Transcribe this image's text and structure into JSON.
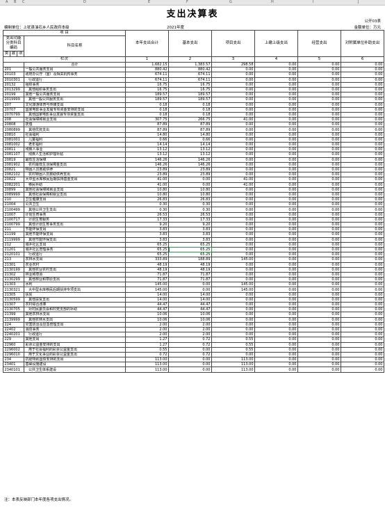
{
  "sheet_columns": [
    "A",
    "B",
    "C",
    "D",
    "E",
    "F",
    "G",
    "H",
    "I",
    "J"
  ],
  "title": "支出决算表",
  "form_no": "公开03表",
  "unit": "编制单位：上犹县油石乡人民政府本级",
  "year": "2021年度",
  "money_unit": "金额单位：万元",
  "headers": {
    "item": "项    目",
    "code": "支出功能分类科目编码",
    "name": "科目名称",
    "total": "本年支出合计",
    "basic": "基本支出",
    "project": "项目支出",
    "upper": "上缴上级支出",
    "business": "经营支出",
    "subsidy": "对附属单位补助支出",
    "lei": "类",
    "kuan": "款",
    "xiang": "项",
    "lanci": "栏次",
    "col_nums": [
      "1",
      "2",
      "3",
      "4",
      "5",
      "6"
    ]
  },
  "rows": [
    {
      "code": "",
      "name": "合计",
      "v": [
        "1,682.15",
        "1,383.57",
        "298.58",
        "0.00",
        "0.00",
        "0.00"
      ]
    },
    {
      "code": "201",
      "name": "一般公共服务支出",
      "v": [
        "880.42",
        "880.42",
        "0.00",
        "0.00",
        "0.00",
        "0.00"
      ]
    },
    {
      "code": "20103",
      "name": "政府办公厅（室）及相关机构事务",
      "v": [
        "674.11",
        "674.11",
        "0.00",
        "0.00",
        "0.00",
        "0.00"
      ]
    },
    {
      "code": "2010301",
      "name": "行政运行",
      "v": [
        "674.11",
        "674.11",
        "0.00",
        "0.00",
        "0.00",
        "0.00"
      ]
    },
    {
      "code": "20132",
      "name": "组织事务",
      "v": [
        "16.75",
        "16.75",
        "0.00",
        "0.00",
        "0.00",
        "0.00"
      ]
    },
    {
      "code": "2013299",
      "name": "其他组织事务支出",
      "v": [
        "16.75",
        "16.75",
        "0.00",
        "0.00",
        "0.00",
        "0.00"
      ]
    },
    {
      "code": "20199",
      "name": "其他一般公共服务支出",
      "v": [
        "189.57",
        "189.57",
        "0.00",
        "0.00",
        "0.00",
        "0.00"
      ]
    },
    {
      "code": "2019999",
      "name": "其他一般公共服务支出",
      "v": [
        "189.57",
        "189.57",
        "0.00",
        "0.00",
        "0.00",
        "0.00"
      ]
    },
    {
      "code": "207",
      "name": "文化旅游体育与传媒支出",
      "v": [
        "0.18",
        "0.18",
        "0.00",
        "0.00",
        "0.00",
        "0.00"
      ]
    },
    {
      "code": "20707",
      "name": "国家电影事业发展专项资金安排的支出",
      "v": [
        "0.18",
        "0.18",
        "0.00",
        "0.00",
        "0.00",
        "0.00"
      ]
    },
    {
      "code": "2070799",
      "name": "其他国家电影事业发展专项资金支出",
      "v": [
        "0.18",
        "0.18",
        "0.00",
        "0.00",
        "0.00",
        "0.00"
      ]
    },
    {
      "code": "208",
      "name": "社会保障和就业支出",
      "v": [
        "307.75",
        "266.75",
        "41.00",
        "0.00",
        "0.00",
        "0.00"
      ]
    },
    {
      "code": "20808",
      "name": "抚恤",
      "v": [
        "87.89",
        "87.89",
        "0.00",
        "0.00",
        "0.00",
        "0.00"
      ]
    },
    {
      "code": "2080899",
      "name": "其他优抚支出",
      "v": [
        "87.89",
        "87.89",
        "0.00",
        "0.00",
        "0.00",
        "0.00"
      ]
    },
    {
      "code": "20810",
      "name": "社会福利",
      "v": [
        "14.80",
        "14.80",
        "0.00",
        "0.00",
        "0.00",
        "0.00"
      ]
    },
    {
      "code": "2081001",
      "name": "儿童福利",
      "v": [
        "0.66",
        "0.66",
        "0.00",
        "0.00",
        "0.00",
        "0.00"
      ]
    },
    {
      "code": "2081002",
      "name": "老年福利",
      "v": [
        "14.14",
        "14.14",
        "0.00",
        "0.00",
        "0.00",
        "0.00"
      ]
    },
    {
      "code": "20811",
      "name": "残疾人事业",
      "v": [
        "13.12",
        "13.12",
        "0.00",
        "0.00",
        "0.00",
        "0.00"
      ]
    },
    {
      "code": "2081107",
      "name": "残疾人生活和护理补贴",
      "v": [
        "13.12",
        "13.12",
        "0.00",
        "0.00",
        "0.00",
        "0.00"
      ]
    },
    {
      "code": "20819",
      "name": "最低生活保障",
      "v": [
        "146.26",
        "146.26",
        "0.00",
        "0.00",
        "0.00",
        "0.00"
      ]
    },
    {
      "code": "2081902",
      "name": "农村最低生活保障金支出",
      "v": [
        "146.26",
        "146.26",
        "0.00",
        "0.00",
        "0.00",
        "0.00"
      ]
    },
    {
      "code": "20821",
      "name": "特困人员救助供养",
      "v": [
        "23.89",
        "23.89",
        "0.00",
        "0.00",
        "0.00",
        "0.00"
      ]
    },
    {
      "code": "2082102",
      "name": "农村特困人员救助供养支出",
      "v": [
        "23.89",
        "23.89",
        "0.00",
        "0.00",
        "0.00",
        "0.00"
      ]
    },
    {
      "code": "20822",
      "name": "大中型水库移民后期扶持基金支出",
      "v": [
        "41.00",
        "0.00",
        "41.00",
        "0.00",
        "0.00",
        "0.00"
      ]
    },
    {
      "code": "2082201",
      "name": "移民补助",
      "v": [
        "41.00",
        "0.00",
        "41.00",
        "0.00",
        "0.00",
        "0.00"
      ]
    },
    {
      "code": "20899",
      "name": "其他社会保障和就业支出",
      "v": [
        "10.80",
        "10.80",
        "0.00",
        "0.00",
        "0.00",
        "0.00"
      ]
    },
    {
      "code": "2089999",
      "name": "其他社会保障和就业支出",
      "v": [
        "10.80",
        "10.80",
        "0.00",
        "0.00",
        "0.00",
        "0.00"
      ]
    },
    {
      "code": "210",
      "name": "卫生健康支出",
      "v": [
        "26.83",
        "26.83",
        "0.00",
        "0.00",
        "0.00",
        "0.00"
      ]
    },
    {
      "code": "21004",
      "name": "公共卫生",
      "v": [
        "0.30",
        "0.30",
        "0.00",
        "0.00",
        "0.00",
        "0.00"
      ]
    },
    {
      "code": "2100499",
      "name": "其他公共卫生支出",
      "v": [
        "0.30",
        "0.30",
        "0.00",
        "0.00",
        "0.00",
        "0.00"
      ]
    },
    {
      "code": "21007",
      "name": "计划生育事务",
      "v": [
        "26.53",
        "26.53",
        "0.00",
        "0.00",
        "0.00",
        "0.00"
      ]
    },
    {
      "code": "2100717",
      "name": "计划生育服务",
      "v": [
        "17.33",
        "17.33",
        "0.00",
        "0.00",
        "0.00",
        "0.00"
      ]
    },
    {
      "code": "2100799",
      "name": "其他计划生育事务支出",
      "v": [
        "9.20",
        "9.20",
        "0.00",
        "0.00",
        "0.00",
        "0.00"
      ]
    },
    {
      "code": "211",
      "name": "节能环保支出",
      "v": [
        "3.83",
        "3.83",
        "0.00",
        "0.00",
        "0.00",
        "0.00"
      ]
    },
    {
      "code": "21199",
      "name": "其他节能环保支出",
      "v": [
        "3.83",
        "3.83",
        "0.00",
        "0.00",
        "0.00",
        "0.00"
      ]
    },
    {
      "code": "2119999",
      "name": "其他节能环保支出",
      "v": [
        "3.83",
        "3.83",
        "0.00",
        "0.00",
        "0.00",
        "0.00"
      ]
    },
    {
      "code": "212",
      "name": "城乡社区支出",
      "v": [
        "65.25",
        "65.25",
        "0.00",
        "0.00",
        "0.00",
        "0.00"
      ]
    },
    {
      "code": "21201",
      "name": "城乡社区管理事务",
      "v": [
        "65.25",
        "65.25",
        "0.00",
        "0.00",
        "0.00",
        "0.00"
      ]
    },
    {
      "code": "2120101",
      "name": "行政运行",
      "v": [
        "65.25",
        "65.25",
        "0.00",
        "0.00",
        "0.00",
        "0.00"
      ]
    },
    {
      "code": "213",
      "name": "农林水支出",
      "v": [
        "333.89",
        "188.89",
        "145.00",
        "0.00",
        "0.00",
        "0.00"
      ]
    },
    {
      "code": "21301",
      "name": "农业农村",
      "v": [
        "48.19",
        "48.19",
        "0.00",
        "0.00",
        "0.00",
        "0.00"
      ]
    },
    {
      "code": "2130199",
      "name": "其他农业农村支出",
      "v": [
        "48.19",
        "48.19",
        "0.00",
        "0.00",
        "0.00",
        "0.00"
      ]
    },
    {
      "code": "21302",
      "name": "林业和草原",
      "v": [
        "71.87",
        "71.87",
        "0.00",
        "0.00",
        "0.00",
        "0.00"
      ]
    },
    {
      "code": "2130299",
      "name": "其他林业和草原支出",
      "v": [
        "71.87",
        "71.87",
        "0.00",
        "0.00",
        "0.00",
        "0.00"
      ]
    },
    {
      "code": "21303",
      "name": "水利",
      "v": [
        "145.00",
        "0.00",
        "145.00",
        "0.00",
        "0.00",
        "0.00"
      ]
    },
    {
      "code": "2130321",
      "name": "大中型水库移民后期扶持专项支出",
      "v": [
        "145.00",
        "0.00",
        "145.00",
        "0.00",
        "0.00",
        "0.00"
      ]
    },
    {
      "code": "21305",
      "name": "扶贫",
      "v": [
        "14.00",
        "14.00",
        "0.00",
        "0.00",
        "0.00",
        "0.00"
      ]
    },
    {
      "code": "2130599",
      "name": "其他扶贫支出",
      "v": [
        "14.00",
        "14.00",
        "0.00",
        "0.00",
        "0.00",
        "0.00"
      ]
    },
    {
      "code": "21307",
      "name": "农村综合改革",
      "v": [
        "44.47",
        "44.47",
        "0.00",
        "0.00",
        "0.00",
        "0.00"
      ]
    },
    {
      "code": "2130705",
      "name": "对村民委员会和村党支部的补助",
      "v": [
        "44.47",
        "44.47",
        "0.00",
        "0.00",
        "0.00",
        "0.00"
      ]
    },
    {
      "code": "21399",
      "name": "其他农林水支出",
      "v": [
        "10.06",
        "10.06",
        "0.00",
        "0.00",
        "0.00",
        "0.00"
      ]
    },
    {
      "code": "2139999",
      "name": "其他农林水支出",
      "v": [
        "10.06",
        "10.06",
        "0.00",
        "0.00",
        "0.00",
        "0.00"
      ]
    },
    {
      "code": "224",
      "name": "灾害防治及应急管理支出",
      "v": [
        "2.00",
        "2.00",
        "0.00",
        "0.00",
        "0.00",
        "0.00"
      ]
    },
    {
      "code": "22402",
      "name": "消防事务",
      "v": [
        "2.00",
        "2.00",
        "0.00",
        "0.00",
        "0.00",
        "0.00"
      ]
    },
    {
      "code": "2240201",
      "name": "行政运行",
      "v": [
        "2.00",
        "2.00",
        "0.00",
        "0.00",
        "0.00",
        "0.00"
      ]
    },
    {
      "code": "229",
      "name": "其他支出",
      "v": [
        "1.27",
        "0.72",
        "0.55",
        "0.00",
        "0.00",
        "0.00"
      ]
    },
    {
      "code": "22960",
      "name": "彩票公益金安排的支出",
      "v": [
        "1.27",
        "0.72",
        "0.55",
        "0.00",
        "0.00",
        "0.00"
      ]
    },
    {
      "code": "2296002",
      "name": "用于社会福利的彩票公益金支出",
      "v": [
        "0.55",
        "0.00",
        "0.55",
        "0.00",
        "0.00",
        "0.00"
      ]
    },
    {
      "code": "2296010",
      "name": "用于文化事业的彩票公益金支出",
      "v": [
        "0.72",
        "0.72",
        "0.00",
        "0.00",
        "0.00",
        "0.00"
      ]
    },
    {
      "code": "234",
      "name": "抗疫特别国债安排的支出",
      "v": [
        "113.00",
        "0.00",
        "113.00",
        "0.00",
        "0.00",
        "0.00"
      ]
    },
    {
      "code": "23401",
      "name": "基础设施建设",
      "v": [
        "113.00",
        "0.00",
        "113.00",
        "0.00",
        "0.00",
        "0.00"
      ]
    },
    {
      "code": "2340101",
      "name": "公共卫生体系建设",
      "v": [
        "113.00",
        "0.00",
        "113.00",
        "0.00",
        "0.00",
        "0.00"
      ]
    }
  ],
  "note": "注：本表反映部门本年度各项支出情况。"
}
